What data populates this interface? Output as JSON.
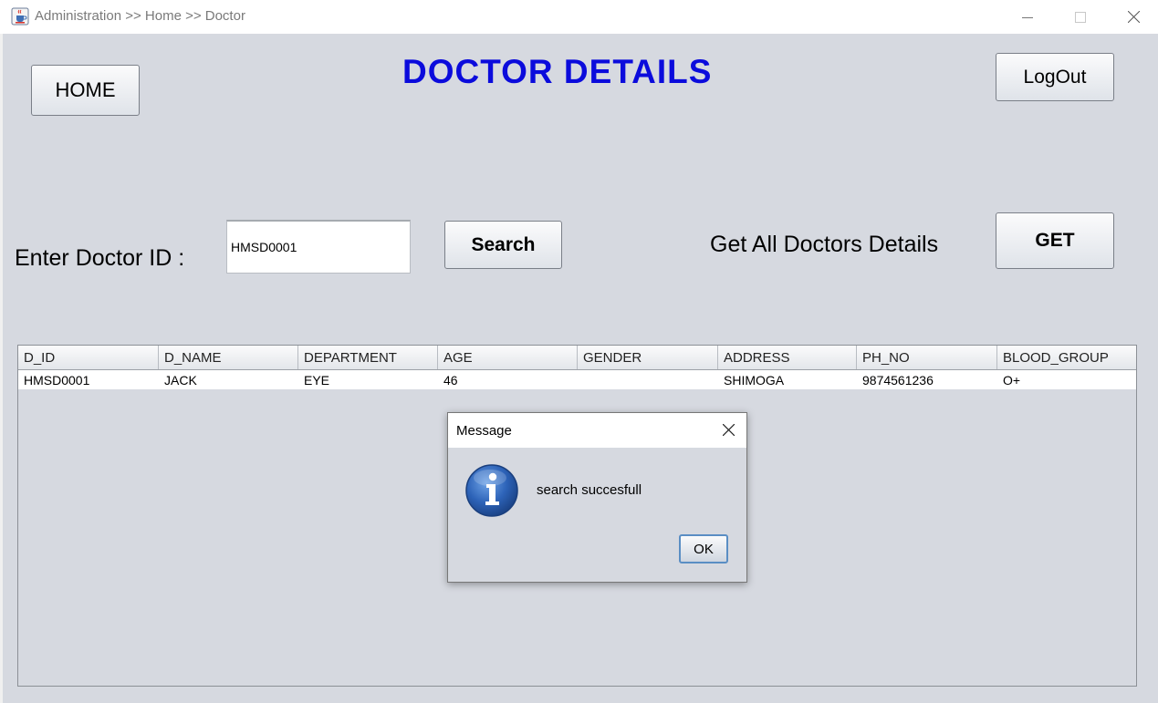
{
  "window": {
    "title": "Administration >> Home >> Doctor",
    "icon": "java-cup-icon"
  },
  "header": {
    "home_label": "HOME",
    "title": "DOCTOR DETAILS",
    "logout_label": "LogOut",
    "title_color": "#0b0bdc"
  },
  "search": {
    "label": "Enter Doctor ID :",
    "value": "HMSD0001",
    "button_label": "Search"
  },
  "get_all": {
    "label": "Get All Doctors Details",
    "button_label": "GET"
  },
  "table": {
    "columns": [
      "D_ID",
      "D_NAME",
      "DEPARTMENT",
      "AGE",
      "GENDER",
      "ADDRESS",
      "PH_NO",
      "BLOOD_GROUP"
    ],
    "rows": [
      [
        "HMSD0001",
        "JACK",
        "EYE",
        "46",
        "",
        "SHIMOGA",
        "9874561236",
        "O+"
      ]
    ]
  },
  "dialog": {
    "title": "Message",
    "message": "search succesfull",
    "ok_label": "OK",
    "icon": "information-icon"
  }
}
